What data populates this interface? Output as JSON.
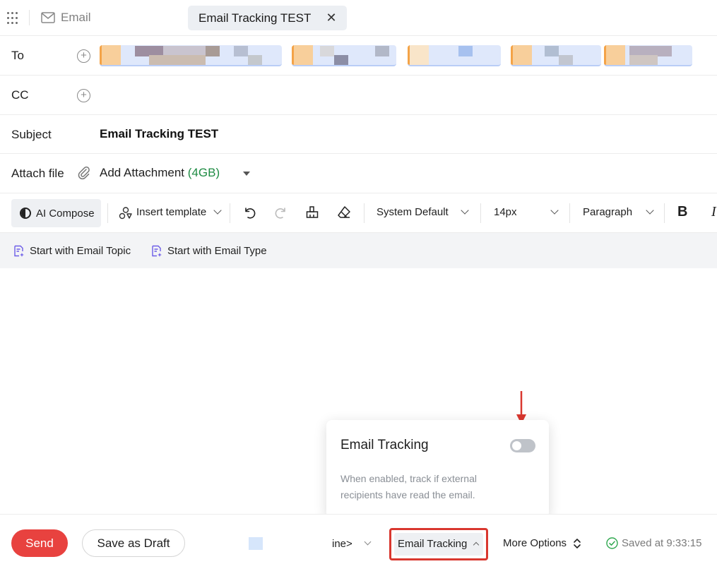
{
  "topbar": {
    "app_label": "Email",
    "tab_title": "Email Tracking TEST",
    "tab_close": "✕"
  },
  "fields": {
    "to_label": "To",
    "cc_label": "CC",
    "subject_label": "Subject",
    "subject_value": "Email Tracking TEST",
    "attach_label": "Attach file",
    "attach_action": "Add Attachment",
    "attach_size": "(4GB)"
  },
  "toolbar": {
    "ai_compose": "AI Compose",
    "insert_template": "Insert template",
    "font_family": "System Default",
    "font_size": "14px",
    "block_style": "Paragraph",
    "bold": "B",
    "italic": "I"
  },
  "suggestions": {
    "topic": "Start with Email Topic",
    "type": "Start with Email Type"
  },
  "popover": {
    "title": "Email Tracking",
    "description": "When enabled, track if external recipients have read the email.",
    "toggle_on": false
  },
  "bottombar": {
    "send": "Send",
    "save_draft": "Save as Draft",
    "signature_partial": "ine>",
    "email_tracking": "Email Tracking",
    "more_options": "More Options",
    "saved_status": "Saved at 9:33:15"
  },
  "colors": {
    "send": "#e8423f",
    "highlight": "#d9372f",
    "attach_size": "#1f8c44",
    "arrow": "#d9372f"
  }
}
